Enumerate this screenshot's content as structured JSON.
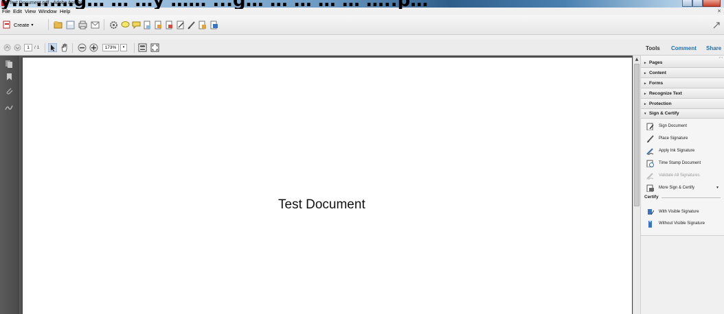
{
  "window": {
    "title": "Test Document.pdf - Adobe Acrobat",
    "overlay_banner": "y… ...…g… … …y …… ...g… … … … … …..p…"
  },
  "menu": {
    "items": [
      "File",
      "Edit",
      "View",
      "Window",
      "Help"
    ],
    "close_glyph": "×"
  },
  "toolbar": {
    "create_label": "Create",
    "create_arrow": "▾"
  },
  "nav": {
    "page_current": "1",
    "page_total": "/ 1",
    "zoom": "173%",
    "zoom_arrow": "▾"
  },
  "tabs": {
    "tools": "Tools",
    "comment": "Comment",
    "share": "Share"
  },
  "document": {
    "text": "Test Document"
  },
  "right_panel": {
    "groups": [
      {
        "label": "Pages",
        "arrow": "▸"
      },
      {
        "label": "Content",
        "arrow": "▸"
      },
      {
        "label": "Forms",
        "arrow": "▸"
      },
      {
        "label": "Recognize Text",
        "arrow": "▸"
      },
      {
        "label": "Protection",
        "arrow": "▸"
      },
      {
        "label": "Sign & Certify",
        "arrow": "▾"
      }
    ],
    "sign_tools": [
      {
        "label": "Sign Document",
        "icon": "sign-document-icon",
        "enabled": true
      },
      {
        "label": "Place Signature",
        "icon": "pen-icon",
        "enabled": true
      },
      {
        "label": "Apply Ink Signature",
        "icon": "ink-signature-icon",
        "enabled": true
      },
      {
        "label": "Time Stamp Document",
        "icon": "time-stamp-icon",
        "enabled": true
      },
      {
        "label": "Validate All Signatures",
        "icon": "validate-icon",
        "enabled": false
      },
      {
        "label": "More Sign & Certify",
        "icon": "more-sign-icon",
        "enabled": true
      }
    ],
    "more_arrow": "▾",
    "certify_label": "Certify",
    "certify_tools": [
      {
        "label": "With Visible Signature",
        "icon": "visible-signature-icon"
      },
      {
        "label": "Without Visible Signature",
        "icon": "invisible-signature-icon"
      }
    ]
  },
  "colors": {
    "titlebar_accent": "#2f5e8a",
    "acrobat_red": "#c8171e",
    "comment_tab": "#1f6fb2",
    "share_tab": "#1f6fb2",
    "doc_bg": "#545454"
  }
}
